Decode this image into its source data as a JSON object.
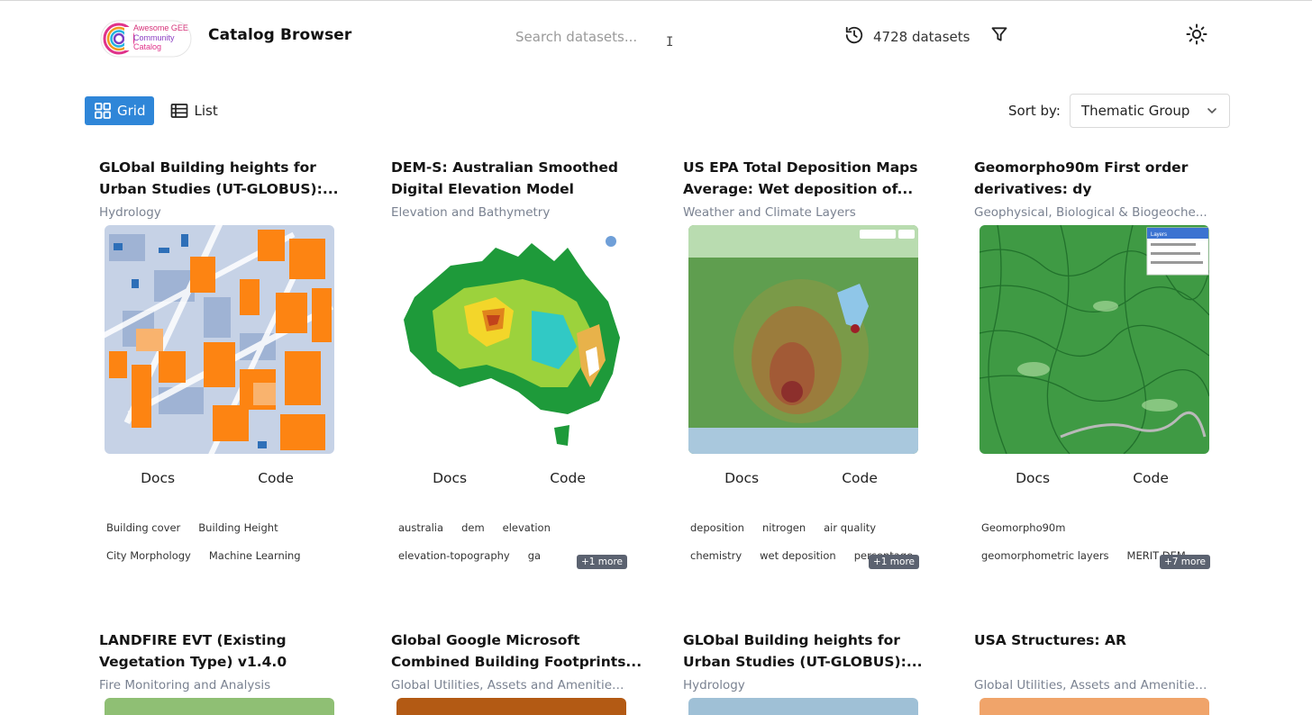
{
  "header": {
    "logo_text": [
      "Awesome GEE",
      "Community",
      "Catalog"
    ],
    "title": "Catalog Browser",
    "search_placeholder": "Search datasets...",
    "dataset_count": "4728 datasets",
    "icons": [
      "logo-icon",
      "history-icon",
      "filter-icon",
      "sun-icon"
    ]
  },
  "view": {
    "grid_label": "Grid",
    "list_label": "List",
    "active": "Grid"
  },
  "sort": {
    "label": "Sort by:",
    "value": "Thematic Group"
  },
  "cards": [
    {
      "title": "GLObal Building heights for Urban Studies (UT-GLOBUS):...",
      "group": "Hydrology",
      "docs": "Docs",
      "code": "Code",
      "tags": [
        [
          "Building cover",
          "Building Height"
        ],
        [
          "City Morphology",
          "Machine Learning"
        ]
      ],
      "more": ""
    },
    {
      "title": "DEM-S: Australian Smoothed Digital Elevation Model",
      "group": "Elevation and Bathymetry",
      "docs": "Docs",
      "code": "Code",
      "tags": [
        [
          "australia",
          "dem",
          "elevation"
        ],
        [
          "elevation-topography",
          "ga"
        ]
      ],
      "more": "+1 more"
    },
    {
      "title": "US EPA Total Deposition Maps Average: Wet deposition of...",
      "group": "Weather and Climate Layers",
      "docs": "Docs",
      "code": "Code",
      "tags": [
        [
          "deposition",
          "nitrogen",
          "air quality"
        ],
        [
          "chemistry",
          "wet deposition",
          "percentage"
        ]
      ],
      "more": "+1 more"
    },
    {
      "title": "Geomorpho90m First order derivatives: dy",
      "group": "Geophysical, Biological & Biogeoche...",
      "docs": "Docs",
      "code": "Code",
      "tags": [
        [
          "Geomorpho90m"
        ],
        [
          "geomorphometric layers",
          "MERIT DEM"
        ]
      ],
      "more": "+7 more"
    },
    {
      "title": "LANDFIRE EVT (Existing Vegetation Type) v1.4.0",
      "group": "Fire Monitoring and Analysis"
    },
    {
      "title": "Global Google Microsoft Combined Building Footprints...",
      "group": "Global Utilities, Assets and Amenities ..."
    },
    {
      "title": "GLObal Building heights for Urban Studies (UT-GLOBUS):...",
      "group": "Hydrology"
    },
    {
      "title": "USA Structures: AR",
      "group": "Global Utilities, Assets and Amenities ..."
    }
  ],
  "map_ui_text": {
    "card4_layers": "Layers"
  },
  "colors": {
    "accent": "#2f86d8",
    "more_badge": "#5b6270",
    "group_text": "#7a8291"
  }
}
